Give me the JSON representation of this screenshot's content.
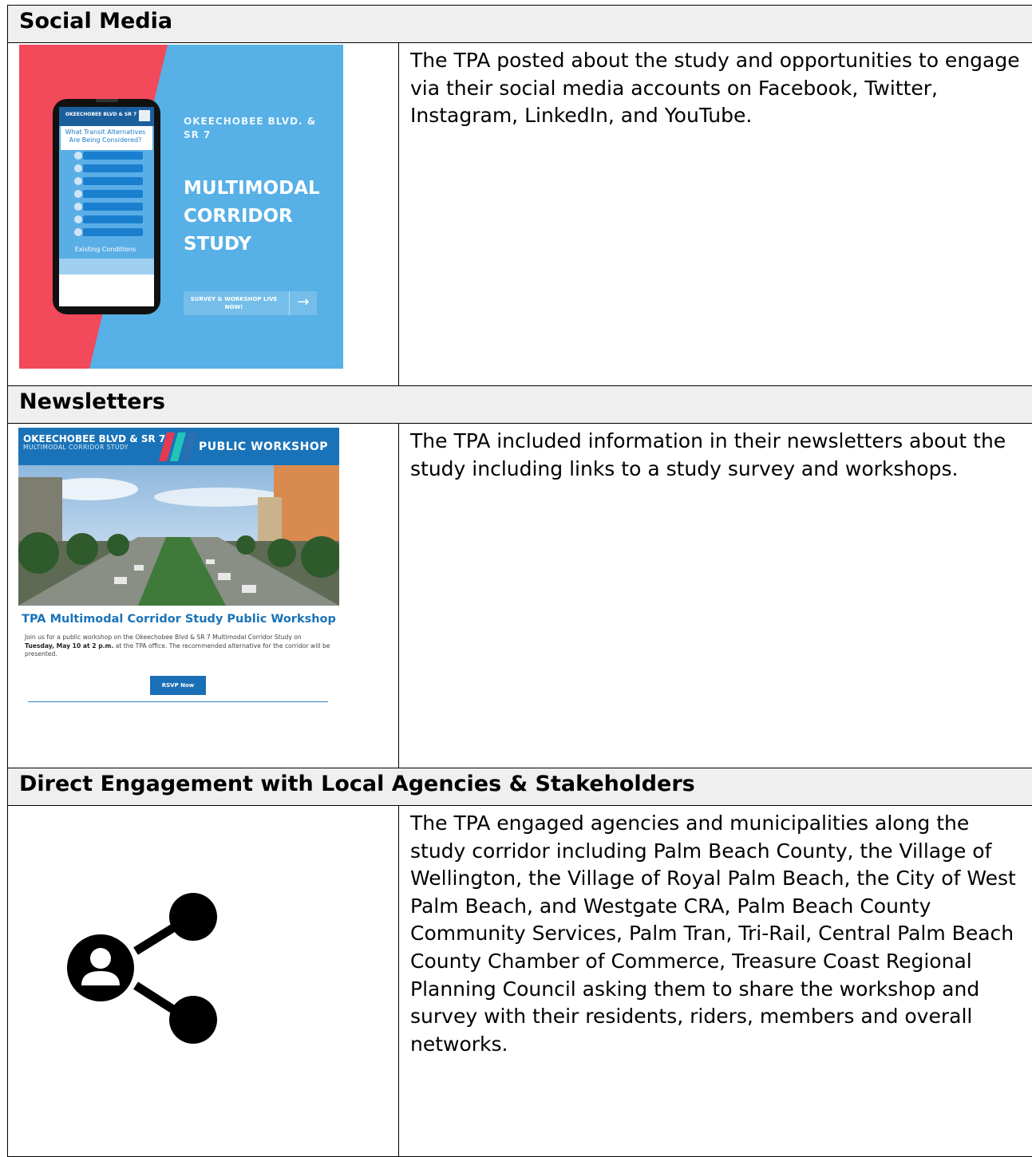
{
  "sections": [
    {
      "heading": "Social Media",
      "description": "The TPA posted about the study and opportunities to engage via their social media accounts on Facebook, Twitter, Instagram, LinkedIn, and YouTube.",
      "graphic": {
        "kicker": "OKEECHOBEE BLVD. & SR 7",
        "title": "MULTIMODAL CORRIDOR STUDY",
        "cta": "SURVEY & WORKSHOP LIVE NOW!",
        "cta_arrow": "→",
        "phone_header": "OKEECHOBEE BLVD & SR 7",
        "phone_question": "What Transit Alternatives Are Being Considered?",
        "phone_existing": "Existing Conditions",
        "colors": {
          "left_panel": "#f2495b",
          "right_panel": "#57b0e6"
        }
      }
    },
    {
      "heading": "Newsletters",
      "description": "The TPA included information in their newsletters about the study including links to a study survey and workshops.",
      "graphic": {
        "banner_title": "OKEECHOBEE BLVD & SR 7",
        "banner_subtitle": "MULTIMODAL CORRIDOR STUDY",
        "banner_right": "PUBLIC WORKSHOP",
        "headline": "TPA Multimodal Corridor Study Public Workshop",
        "body_lead": "Join us for a public workshop on the Okeechobee Blvd & SR 7 Multimodal Corridor Study on",
        "body_date": "Tuesday, May 10 at 2 p.m.",
        "body_tail": "at the TPA office. The recommended alternative for the corridor will be presented.",
        "button": "RSVP Now",
        "colors": {
          "brand_blue": "#1a73b8"
        }
      }
    },
    {
      "heading": "Direct Engagement with Local Agencies & Stakeholders",
      "description": "The TPA engaged agencies and municipalities along the study corridor including Palm Beach County, the Village of Wellington, the Village of Royal Palm Beach, the City of West Palm Beach, and Westgate CRA, Palm Beach County Community Services, Palm Tran, Tri-Rail, Central Palm Beach County Chamber of Commerce, Treasure Coast Regional Planning Council asking them to share the workshop and survey with their residents, riders, members and overall networks.",
      "icon": "share-person-icon"
    }
  ]
}
